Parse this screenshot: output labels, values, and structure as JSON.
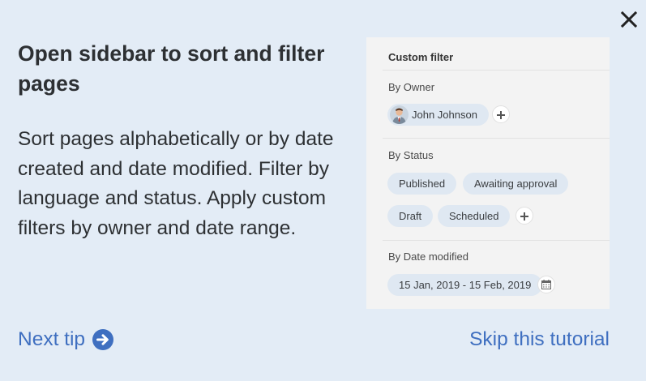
{
  "dialog": {
    "title": "Open sidebar to sort and filter pages",
    "description": "Sort pages alphabetically or by date created and date modified. Filter by language and status. Apply custom filters by owner and date range.",
    "close_icon": "close-icon"
  },
  "panel": {
    "title": "Custom filter",
    "owner": {
      "label": "By Owner",
      "chip": "John Johnson"
    },
    "status": {
      "label": "By Status",
      "chips": [
        "Published",
        "Awaiting approval",
        "Draft",
        "Scheduled"
      ]
    },
    "date": {
      "label": "By Date modified",
      "range": "15 Jan, 2019 - 15 Feb, 2019"
    }
  },
  "footer": {
    "next_tip": "Next tip",
    "skip": "Skip this tutorial"
  },
  "colors": {
    "background": "#e3ecf6",
    "link": "#3f6fc0",
    "chip": "#dfe8f2",
    "panel": "#f3f3f3"
  }
}
